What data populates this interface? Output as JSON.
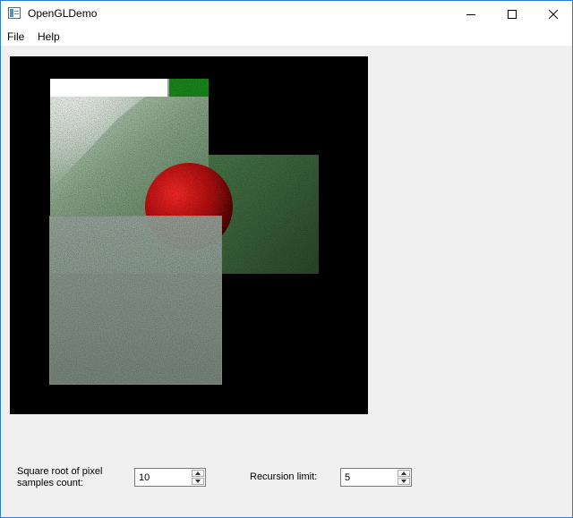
{
  "window": {
    "title": "OpenGLDemo",
    "icon": "app-window-icon"
  },
  "titlebar_buttons": {
    "minimize_icon": "minimize-icon",
    "maximize_icon": "maximize-icon",
    "close_icon": "close-icon"
  },
  "menu": {
    "file": "File",
    "help": "Help"
  },
  "render": {
    "background": "#000000",
    "sphere_color": "#cc1111",
    "wall_color": "#2e5a2e",
    "light_color": "#ffffff",
    "selection_color": "#4a90e2"
  },
  "controls": {
    "samples_label": "Square root of pixel samples count:",
    "samples_value": "10",
    "recursion_label": "Recursion limit:",
    "recursion_value": "5"
  }
}
